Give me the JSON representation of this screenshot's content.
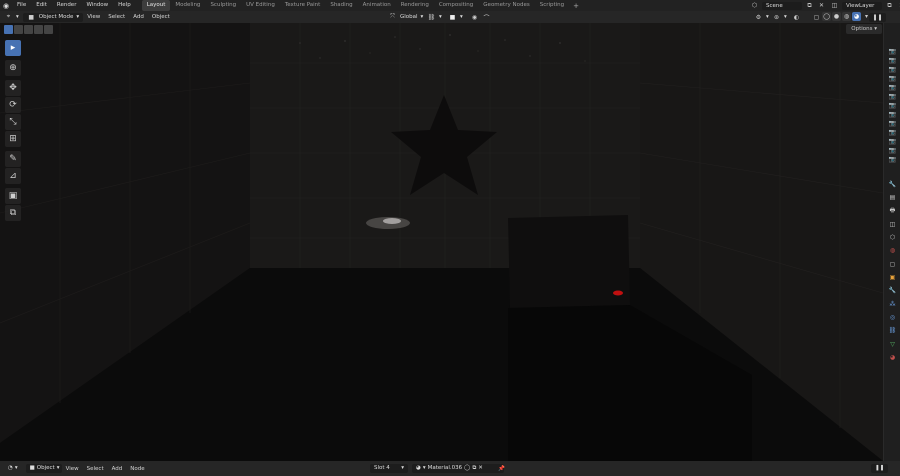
{
  "menubar": {
    "items": [
      "File",
      "Edit",
      "Render",
      "Window",
      "Help"
    ],
    "workspaces": [
      "Layout",
      "Modeling",
      "Sculpting",
      "UV Editing",
      "Texture Paint",
      "Shading",
      "Animation",
      "Rendering",
      "Compositing",
      "Geometry Nodes",
      "Scripting"
    ],
    "active_workspace": "Layout",
    "add_label": "+",
    "scene": "Scene",
    "view_layer": "ViewLayer"
  },
  "viewport_header": {
    "mode": "Object Mode",
    "menus": [
      "View",
      "Select",
      "Add",
      "Object"
    ],
    "transform_orientation": "Global",
    "options_label": "Options"
  },
  "toolbar": {
    "tools": [
      {
        "name": "select-box-tool",
        "glyph": "▸",
        "active": true
      },
      {
        "name": "cursor-tool",
        "glyph": "⊕",
        "active": false
      },
      {
        "name": "move-tool",
        "glyph": "✥",
        "active": false
      },
      {
        "name": "rotate-tool",
        "glyph": "⟳",
        "active": false
      },
      {
        "name": "scale-tool",
        "glyph": "⤡",
        "active": false
      },
      {
        "name": "transform-tool",
        "glyph": "⊞",
        "active": false
      },
      {
        "name": "annotate-tool",
        "glyph": "✎",
        "active": false
      },
      {
        "name": "measure-tool",
        "glyph": "📐",
        "active": false
      },
      {
        "name": "add-cube-tool",
        "glyph": "▣",
        "active": false
      },
      {
        "name": "add-object-tool",
        "glyph": "⧉",
        "active": false
      }
    ]
  },
  "bottom_bar": {
    "mode": "Object",
    "menus": [
      "View",
      "Select",
      "Add",
      "Node"
    ],
    "slot": "Slot 4",
    "material": "Material.036"
  },
  "colors": {
    "accent": "#4772b3",
    "red_light": "#c01010"
  },
  "icons": {
    "blender_logo": "blender-logo-icon",
    "render_engine": "camera-icon"
  }
}
